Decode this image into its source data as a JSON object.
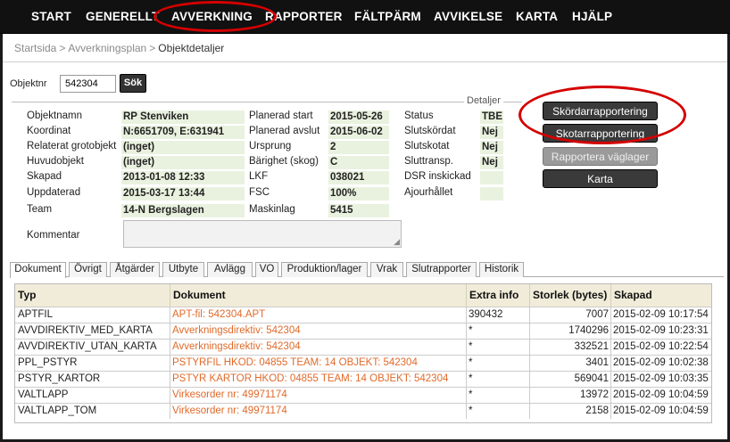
{
  "nav": {
    "items": [
      "START",
      "GENERELLT",
      "AVVERKNING",
      "RAPPORTER",
      "FÄLTPÄRM",
      "AVVIKELSE",
      "KARTA",
      "HJÄLP"
    ]
  },
  "breadcrumb": {
    "items": [
      "Startsida",
      "Avverkningsplan"
    ],
    "current": "Objektdetaljer"
  },
  "search": {
    "label": "Objektnr",
    "value": "542304",
    "button": "Sök"
  },
  "details": {
    "legend": "Detaljer",
    "col1": [
      {
        "label": "Objektnamn",
        "value": "RP Stenviken"
      },
      {
        "label": "Koordinat",
        "value": "N:6651709, E:631941"
      },
      {
        "label": "Relaterat grotobjekt",
        "value": "(inget)"
      },
      {
        "label": "Huvudobjekt",
        "value": "(inget)"
      },
      {
        "label": "Skapad",
        "value": "2013-01-08 12:33"
      },
      {
        "label": "Uppdaterad",
        "value": "2015-03-17 13:44"
      },
      {
        "label": "Team",
        "value": "14-N Bergslagen"
      }
    ],
    "col2": [
      {
        "label": "Planerad start",
        "value": "2015-05-26"
      },
      {
        "label": "Planerad avslut",
        "value": "2015-06-02"
      },
      {
        "label": "Ursprung",
        "value": "2"
      },
      {
        "label": "Bärighet (skog)",
        "value": "C"
      },
      {
        "label": "LKF",
        "value": "038021"
      },
      {
        "label": "FSC",
        "value": "100%"
      },
      {
        "label": "Maskinlag",
        "value": "5415"
      }
    ],
    "col3": [
      {
        "label": "Status",
        "value": "TBE"
      },
      {
        "label": "Slutskördat",
        "value": "Nej"
      },
      {
        "label": "Slutskotat",
        "value": "Nej"
      },
      {
        "label": "Sluttransp.",
        "value": "Nej"
      },
      {
        "label": "DSR inskickad",
        "value": ""
      },
      {
        "label": "Ajourhållet",
        "value": ""
      }
    ],
    "kommentar_label": "Kommentar",
    "kommentar_value": ""
  },
  "actions": {
    "skordar": "Skördarrapportering",
    "skotar": "Skotarrapportering",
    "vaglager": "Rapportera väglager",
    "karta": "Karta"
  },
  "tabs": [
    "Dokument",
    "Övrigt",
    "Åtgärder",
    "Utbyte",
    "Avlägg",
    "VO",
    "Produktion/lager",
    "Vrak",
    "Slutrapporter",
    "Historik"
  ],
  "table": {
    "headers": [
      "Typ",
      "Dokument",
      "Extra info",
      "Storlek (bytes)",
      "Skapad"
    ],
    "rows": [
      [
        "APTFIL",
        "APT-fil: 542304.APT",
        "390432",
        "7007",
        "2015-02-09 10:17:54"
      ],
      [
        "AVVDIREKTIV_MED_KARTA",
        "Avverkningsdirektiv: 542304",
        "*",
        "1740296",
        "2015-02-09 10:23:31"
      ],
      [
        "AVVDIREKTIV_UTAN_KARTA",
        "Avverkningsdirektiv: 542304",
        "*",
        "332521",
        "2015-02-09 10:22:54"
      ],
      [
        "PPL_PSTYR",
        "PSTYRFIL HKOD: 04855 TEAM: 14 OBJEKT: 542304",
        "*",
        "3401",
        "2015-02-09 10:02:38"
      ],
      [
        "PSTYR_KARTOR",
        "PSTYR KARTOR HKOD: 04855 TEAM: 14 OBJEKT: 542304",
        "*",
        "569041",
        "2015-02-09 10:03:35"
      ],
      [
        "VALTLAPP",
        "Virkesorder nr: 49971174",
        "*",
        "13972",
        "2015-02-09 10:04:59"
      ],
      [
        "VALTLAPP_TOM",
        "Virkesorder nr: 49971174",
        "*",
        "2158",
        "2015-02-09 10:04:59"
      ]
    ]
  },
  "colors": {
    "nav_bg": "#111111",
    "highlight_ring": "#d40000",
    "value_bg": "#e9f2df",
    "doc_link": "#e06a2a",
    "header_bg": "#f0ecd9"
  }
}
